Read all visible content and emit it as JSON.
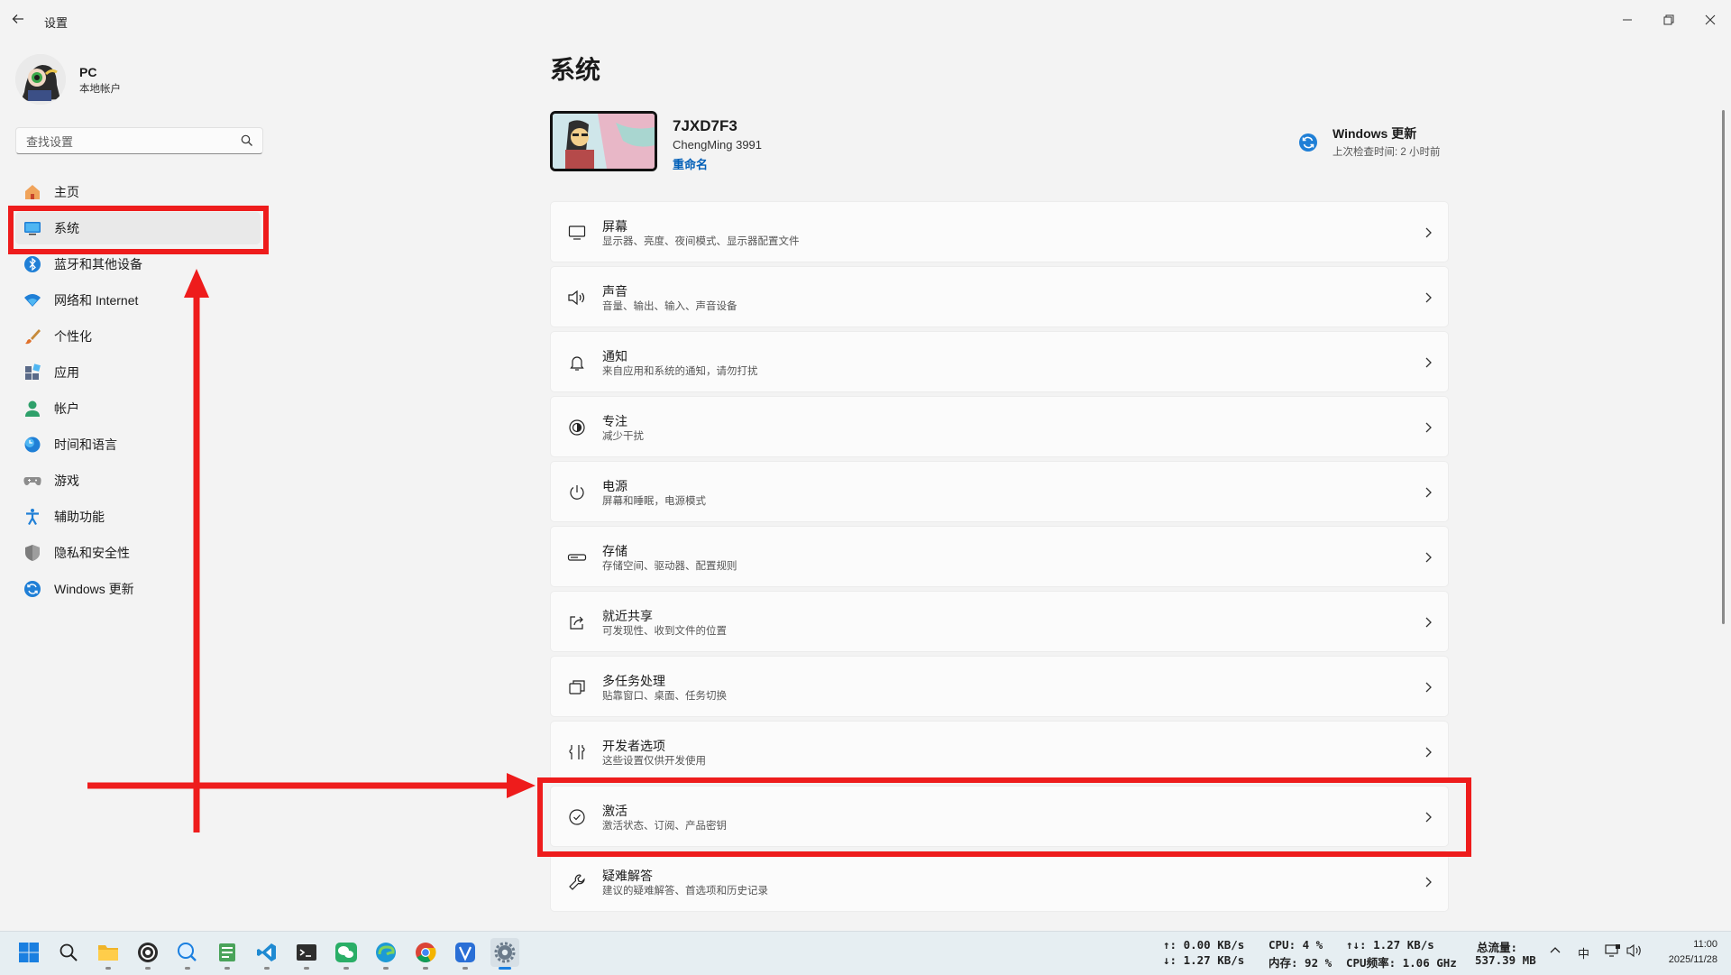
{
  "window": {
    "title": "设置"
  },
  "profile": {
    "name": "PC",
    "account_type": "本地帐户"
  },
  "search": {
    "placeholder": "查找设置"
  },
  "nav": {
    "items": [
      {
        "label": "主页",
        "icon": "home-icon"
      },
      {
        "label": "系统",
        "icon": "system-icon",
        "active": true
      },
      {
        "label": "蓝牙和其他设备",
        "icon": "bluetooth-icon"
      },
      {
        "label": "网络和 Internet",
        "icon": "network-icon"
      },
      {
        "label": "个性化",
        "icon": "brush-icon"
      },
      {
        "label": "应用",
        "icon": "apps-icon"
      },
      {
        "label": "帐户",
        "icon": "account-icon"
      },
      {
        "label": "时间和语言",
        "icon": "globe-clock-icon"
      },
      {
        "label": "游戏",
        "icon": "gamepad-icon"
      },
      {
        "label": "辅助功能",
        "icon": "accessibility-icon"
      },
      {
        "label": "隐私和安全性",
        "icon": "shield-icon"
      },
      {
        "label": "Windows 更新",
        "icon": "update-icon"
      }
    ]
  },
  "main": {
    "title": "系统",
    "device": {
      "name": "7JXD7F3",
      "model": "ChengMing 3991",
      "rename": "重命名"
    },
    "windows_update": {
      "title": "Windows 更新",
      "subtitle": "上次检查时间: 2 小时前"
    },
    "rows": [
      {
        "title": "屏幕",
        "subtitle": "显示器、亮度、夜间模式、显示器配置文件",
        "icon": "monitor-icon"
      },
      {
        "title": "声音",
        "subtitle": "音量、输出、输入、声音设备",
        "icon": "speaker-icon"
      },
      {
        "title": "通知",
        "subtitle": "来自应用和系统的通知，请勿打扰",
        "icon": "bell-icon"
      },
      {
        "title": "专注",
        "subtitle": "减少干扰",
        "icon": "focus-icon"
      },
      {
        "title": "电源",
        "subtitle": "屏幕和睡眠，电源模式",
        "icon": "power-icon"
      },
      {
        "title": "存储",
        "subtitle": "存储空间、驱动器、配置规则",
        "icon": "storage-icon"
      },
      {
        "title": "就近共享",
        "subtitle": "可发现性、收到文件的位置",
        "icon": "share-icon"
      },
      {
        "title": "多任务处理",
        "subtitle": "贴靠窗口、桌面、任务切换",
        "icon": "multitask-icon"
      },
      {
        "title": "开发者选项",
        "subtitle": "这些设置仅供开发使用",
        "icon": "developer-icon"
      },
      {
        "title": "激活",
        "subtitle": "激活状态、订阅、产品密钥",
        "icon": "check-circle-icon"
      },
      {
        "title": "疑难解答",
        "subtitle": "建议的疑难解答、首选项和历史记录",
        "icon": "wrench-icon"
      }
    ]
  },
  "taskbar": {
    "net_up": "↑: 0.00 KB/s",
    "net_down": "↓: 1.27 KB/s",
    "cpu": "CPU: 4 %",
    "mem": "内存: 92 %",
    "total_rate": "↑↓: 1.27 KB/s",
    "cpu_freq": "CPU频率: 1.06 GHz",
    "total_flow_label": "总流量:",
    "total_flow": "537.39 MB",
    "ime": "中",
    "time": "11:00",
    "date": "2025/11/28"
  },
  "colors": {
    "accent": "#005fb8",
    "annotation": "#ee1c1c"
  }
}
